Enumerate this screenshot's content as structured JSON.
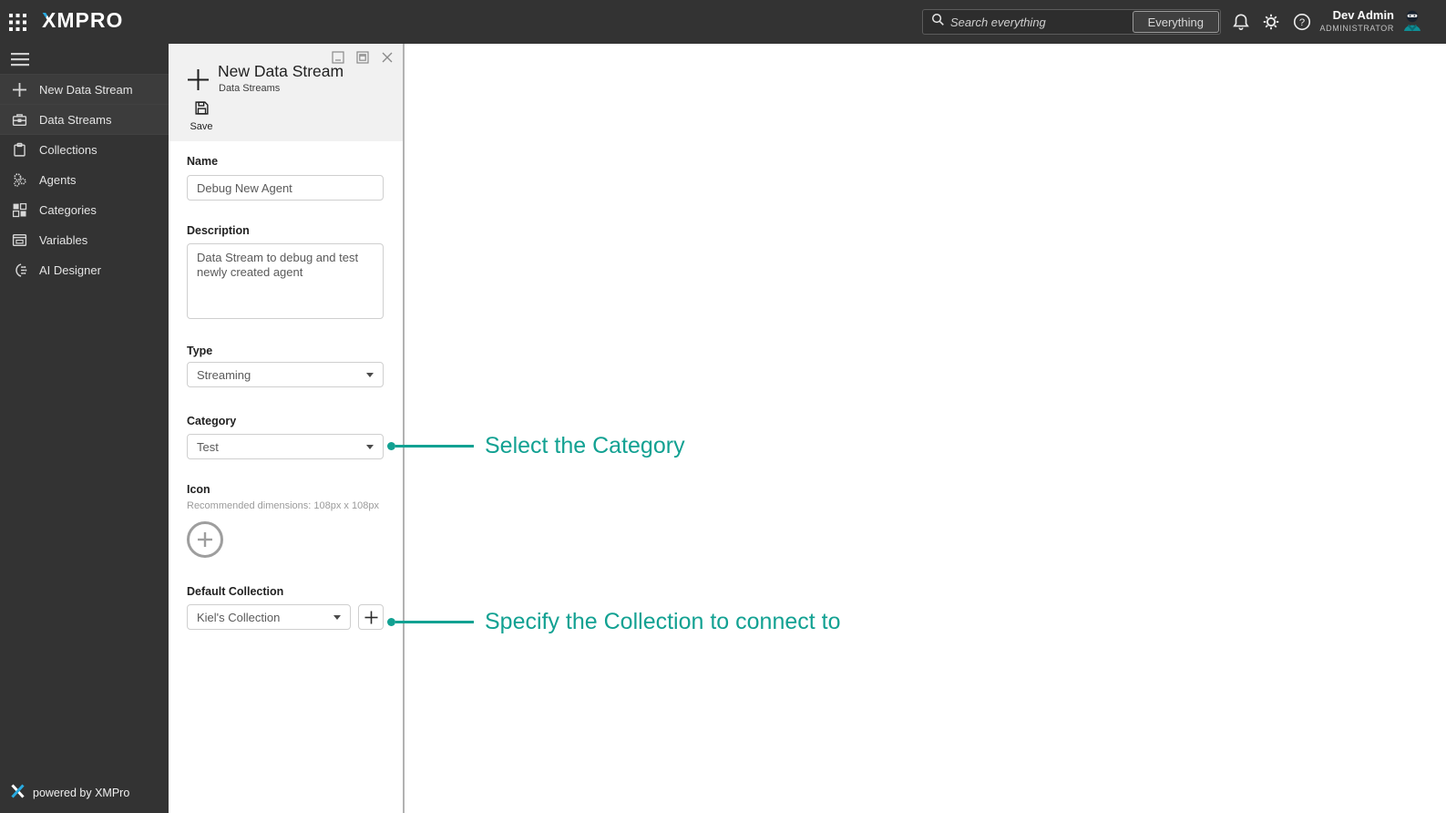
{
  "colors": {
    "accent_teal": "#12a192",
    "logo_cyan": "#29abe2",
    "topbar_bg": "#333333",
    "sidebar_bg": "#333333",
    "panel_header_bg": "#f1f1f1"
  },
  "icons": {
    "help_glyph": "?"
  },
  "topbar": {
    "logo_text": "XMPRO",
    "search": {
      "placeholder": "Search everything",
      "scope_label": "Everything"
    },
    "user": {
      "name": "Dev Admin",
      "role": "ADMINISTRATOR"
    }
  },
  "sidebar": {
    "items": [
      {
        "label": "New Data Stream"
      },
      {
        "label": "Data Streams"
      },
      {
        "label": "Collections"
      },
      {
        "label": "Agents"
      },
      {
        "label": "Categories"
      },
      {
        "label": "Variables"
      },
      {
        "label": "AI Designer"
      }
    ],
    "footer_text": "powered by XMPro"
  },
  "panel": {
    "title": "New Data Stream",
    "subtitle": "Data Streams",
    "save_label": "Save",
    "fields": {
      "name": {
        "label": "Name",
        "value": "Debug New Agent"
      },
      "description": {
        "label": "Description",
        "value": "Data Stream to debug and test newly created agent"
      },
      "type": {
        "label": "Type",
        "value": "Streaming"
      },
      "category": {
        "label": "Category",
        "value": "Test"
      },
      "icon": {
        "label": "Icon",
        "hint": "Recommended dimensions: 108px x 108px"
      },
      "default_collection": {
        "label": "Default Collection",
        "value": "Kiel's Collection"
      }
    }
  },
  "annotations": [
    {
      "text": "Select the Category"
    },
    {
      "text": "Specify the Collection to connect to"
    }
  ]
}
